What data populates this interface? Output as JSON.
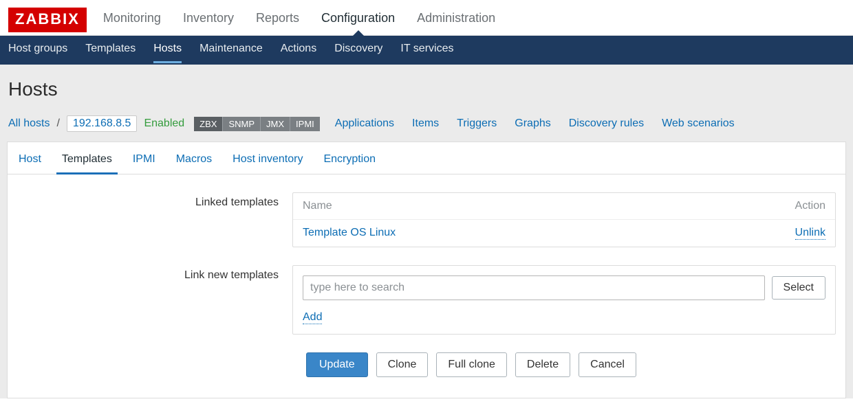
{
  "logo": "ZABBIX",
  "topnav": {
    "items": [
      {
        "label": "Monitoring",
        "active": false
      },
      {
        "label": "Inventory",
        "active": false
      },
      {
        "label": "Reports",
        "active": false
      },
      {
        "label": "Configuration",
        "active": true
      },
      {
        "label": "Administration",
        "active": false
      }
    ]
  },
  "subnav": {
    "items": [
      {
        "label": "Host groups",
        "active": false
      },
      {
        "label": "Templates",
        "active": false
      },
      {
        "label": "Hosts",
        "active": true
      },
      {
        "label": "Maintenance",
        "active": false
      },
      {
        "label": "Actions",
        "active": false
      },
      {
        "label": "Discovery",
        "active": false
      },
      {
        "label": "IT services",
        "active": false
      }
    ]
  },
  "page": {
    "title": "Hosts"
  },
  "breadcrumb": {
    "all_hosts": "All hosts",
    "sep": "/",
    "host_ip": "192.168.8.5",
    "status": "Enabled",
    "badges": [
      "ZBX",
      "SNMP",
      "JMX",
      "IPMI"
    ],
    "links": [
      {
        "label": "Applications"
      },
      {
        "label": "Items"
      },
      {
        "label": "Triggers"
      },
      {
        "label": "Graphs"
      },
      {
        "label": "Discovery rules"
      },
      {
        "label": "Web scenarios"
      }
    ]
  },
  "tabs": [
    {
      "label": "Host",
      "active": false
    },
    {
      "label": "Templates",
      "active": true
    },
    {
      "label": "IPMI",
      "active": false
    },
    {
      "label": "Macros",
      "active": false
    },
    {
      "label": "Host inventory",
      "active": false
    },
    {
      "label": "Encryption",
      "active": false
    }
  ],
  "linked_templates": {
    "label": "Linked templates",
    "header_name": "Name",
    "header_action": "Action",
    "rows": [
      {
        "name": "Template OS Linux",
        "action": "Unlink"
      }
    ]
  },
  "link_new": {
    "label": "Link new templates",
    "placeholder": "type here to search",
    "select": "Select",
    "add": "Add"
  },
  "actions": {
    "update": "Update",
    "clone": "Clone",
    "full_clone": "Full clone",
    "delete": "Delete",
    "cancel": "Cancel"
  }
}
